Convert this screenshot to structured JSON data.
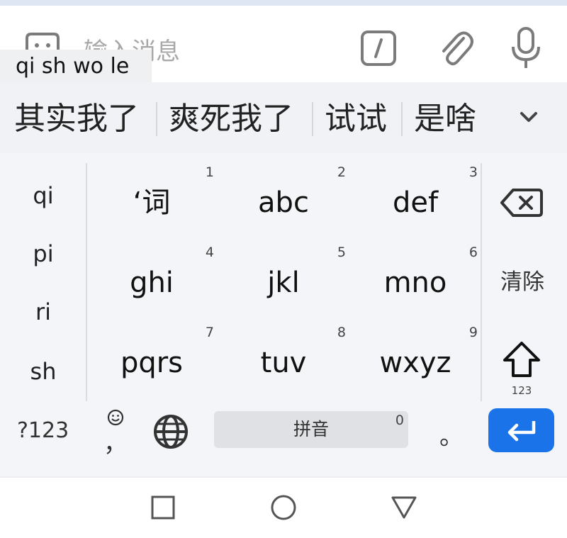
{
  "input_bar": {
    "placeholder": "输入消息",
    "icons": [
      "emoji-icon",
      "command-icon",
      "paperclip-icon",
      "microphone-icon"
    ]
  },
  "composing_text": "qi sh wo le",
  "candidates": {
    "items": [
      "其实我了",
      "爽死我了",
      "试试",
      "是啥"
    ],
    "expand_icon": "chevron-down-icon"
  },
  "keyboard": {
    "pinyin_options": [
      "qi",
      "pi",
      "ri",
      "sh"
    ],
    "keys": [
      {
        "label": "‘词",
        "hint": "1"
      },
      {
        "label": "abc",
        "hint": "2"
      },
      {
        "label": "def",
        "hint": "3"
      },
      {
        "label": "ghi",
        "hint": "4"
      },
      {
        "label": "jkl",
        "hint": "5"
      },
      {
        "label": "mno",
        "hint": "6"
      },
      {
        "label": "pqrs",
        "hint": "7"
      },
      {
        "label": "tuv",
        "hint": "8"
      },
      {
        "label": "wxyz",
        "hint": "9"
      }
    ],
    "delete_icon": "backspace-icon",
    "clear_label": "清除",
    "shift_sub_label": "123",
    "symbols_label": "?123",
    "comma_label": "，",
    "globe_icon": "globe-icon",
    "space_label": "拼音",
    "space_hint": "0",
    "period_label": "。",
    "enter_icon": "enter-icon",
    "enter_color": "#1a73e8"
  },
  "nav": {
    "icons": [
      "recents-square-icon",
      "home-circle-icon",
      "back-triangle-icon"
    ]
  }
}
